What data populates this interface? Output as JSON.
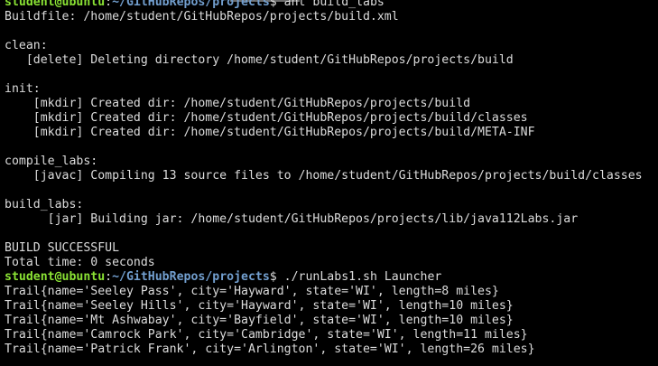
{
  "prompt": {
    "user_host": "student@ubuntu",
    "separator": ":",
    "path": "~/GitHubRepos/projects",
    "symbol": "$"
  },
  "commands": {
    "first": " ant build_labs",
    "second": " ./runLabs1.sh Launcher"
  },
  "output": [
    "Buildfile: /home/student/GitHubRepos/projects/build.xml",
    "",
    "clean:",
    "   [delete] Deleting directory /home/student/GitHubRepos/projects/build",
    "",
    "init:",
    "    [mkdir] Created dir: /home/student/GitHubRepos/projects/build",
    "    [mkdir] Created dir: /home/student/GitHubRepos/projects/build/classes",
    "    [mkdir] Created dir: /home/student/GitHubRepos/projects/build/META-INF",
    "",
    "compile_labs:",
    "    [javac] Compiling 13 source files to /home/student/GitHubRepos/projects/build/classes",
    "",
    "build_labs:",
    "      [jar] Building jar: /home/student/GitHubRepos/projects/lib/java112Labs.jar",
    "",
    "BUILD SUCCESSFUL",
    "Total time: 0 seconds"
  ],
  "trails": [
    "Trail{name='Seeley Pass', city='Hayward', state='WI', length=8 miles}",
    "Trail{name='Seeley Hills', city='Hayward', state='WI', length=10 miles}",
    "Trail{name='Mt Ashwabay', city='Bayfield', state='WI', length=10 miles}",
    "Trail{name='Camrock Park', city='Cambridge', state='WI', length=11 miles}",
    "Trail{name='Patrick Frank', city='Arlington', state='WI', length=26 miles}"
  ],
  "colors": {
    "background": "#000000",
    "text": "#dcdcdc",
    "prompt_user": "#8ae234",
    "prompt_path": "#729fcf"
  }
}
